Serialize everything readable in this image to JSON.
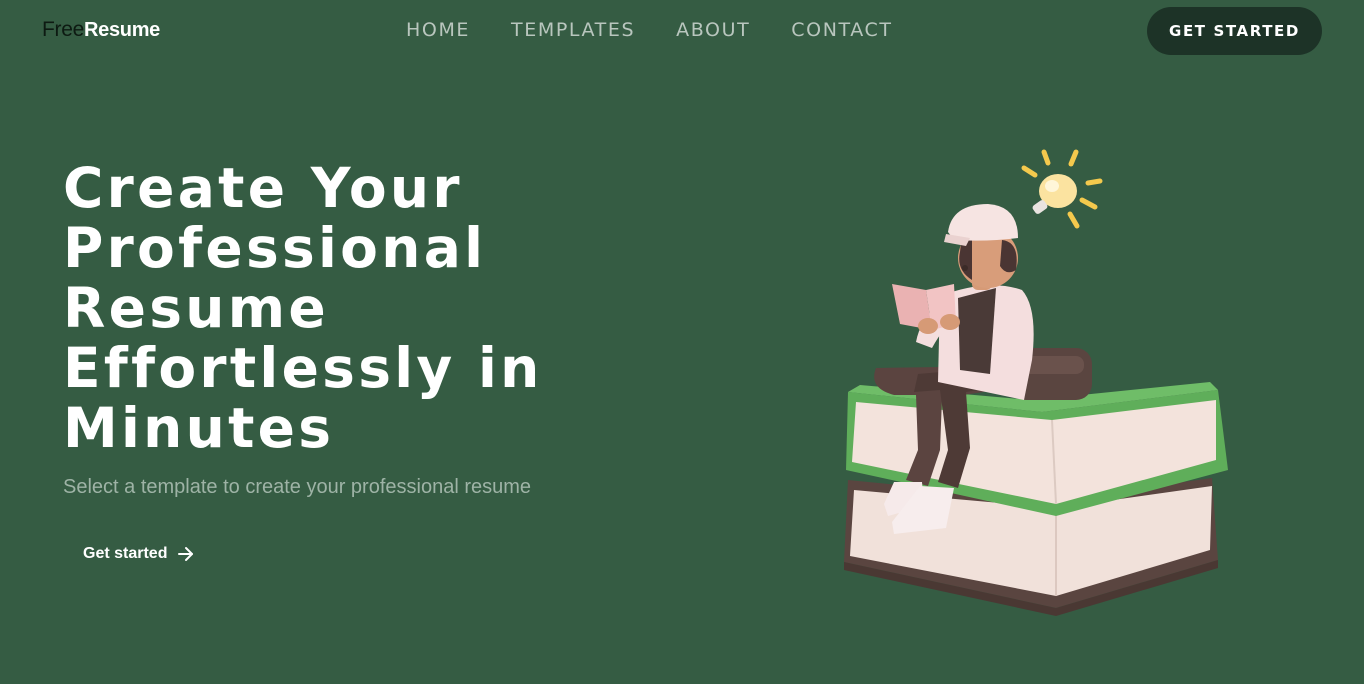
{
  "header": {
    "logo_first": "Free",
    "logo_second": "Resume",
    "nav": [
      {
        "label": "HOME"
      },
      {
        "label": "TEMPLATES"
      },
      {
        "label": "ABOUT"
      },
      {
        "label": "CONTACT"
      }
    ],
    "cta_label": "GET STARTED"
  },
  "hero": {
    "title_lines": [
      "Create Your",
      "Professional",
      "Resume",
      "Effortlessly in",
      "Minutes"
    ],
    "subtitle": "Select a template to create your professional resume",
    "button_label": "Get started",
    "button_icon": "arrow-right-icon",
    "illustration": "person-reading-on-books-with-lightbulb"
  },
  "colors": {
    "background": "#355c43",
    "cta_background": "#1d3327",
    "nav_text": "#b9c6be",
    "subtitle_text": "#9eb3a6",
    "logo_dark": "#0d1a12",
    "book_green": "#5fae5a",
    "book_brown": "#5a4540"
  }
}
